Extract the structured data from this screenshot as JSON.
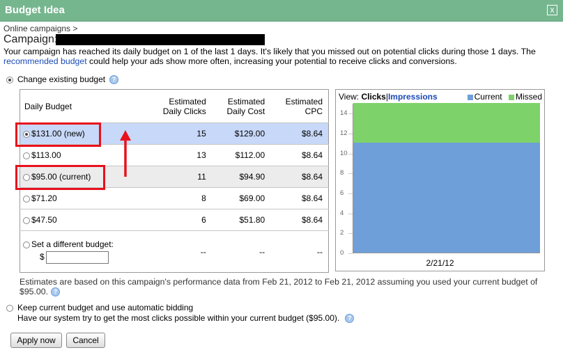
{
  "dialog": {
    "title": "Budget Idea",
    "close_label": "x",
    "breadcrumb": "Online campaigns >",
    "campaign_label": "Campaign:",
    "intro_text_before": "Your campaign has reached its daily budget on 1 of the last 1 days. It's likely that you missed out on potential clicks during those 1 days. The ",
    "intro_link": "recommended budget",
    "intro_text_after": " could help your ads show more often, increasing your potential to receive clicks and conversions."
  },
  "options": {
    "change_label": "Change existing budget",
    "keep_label": "Keep current budget and use automatic bidding",
    "keep_description": "Have our system try to get the most clicks possible within your current budget ($95.00)."
  },
  "table": {
    "headers": {
      "budget": "Daily Budget",
      "clicks_line1": "Estimated",
      "clicks_line2": "Daily Clicks",
      "cost_line1": "Estimated",
      "cost_line2": "Daily Cost",
      "cpc_line1": "Estimated",
      "cpc_line2": "CPC"
    },
    "rows": [
      {
        "budget": "$131.00",
        "tag": "(new)",
        "clicks": "15",
        "cost": "$129.00",
        "cpc": "$8.64"
      },
      {
        "budget": "$113.00",
        "tag": "",
        "clicks": "13",
        "cost": "$112.00",
        "cpc": "$8.64"
      },
      {
        "budget": "$95.00",
        "tag": "(current)",
        "clicks": "11",
        "cost": "$94.90",
        "cpc": "$8.64"
      },
      {
        "budget": "$71.20",
        "tag": "",
        "clicks": "8",
        "cost": "$69.00",
        "cpc": "$8.64"
      },
      {
        "budget": "$47.50",
        "tag": "",
        "clicks": "6",
        "cost": "$51.80",
        "cpc": "$8.64"
      }
    ],
    "different": {
      "label": "Set a different budget:",
      "currency": "$",
      "clicks": "--",
      "cost": "--",
      "cpc": "--"
    }
  },
  "chart_data": {
    "type": "bar",
    "view_label": "View:",
    "view_clicks": "Clicks",
    "view_separator": "|",
    "view_impressions": "Impressions",
    "categories": [
      "2/21/12"
    ],
    "series": [
      {
        "name": "Current",
        "values": [
          11
        ],
        "color": "#6f9fd8"
      },
      {
        "name": "Missed",
        "values": [
          4
        ],
        "color": "#7ed26a"
      }
    ],
    "stacked": true,
    "ylim": [
      0,
      15
    ],
    "yticks": [
      0,
      2,
      4,
      6,
      8,
      10,
      12,
      14
    ],
    "grid": false,
    "legend": "top-right"
  },
  "note": {
    "text": "Estimates are based on this campaign's performance data from Feb 21, 2012 to Feb 21, 2012 assuming you used your current budget of $95.00."
  },
  "buttons": {
    "apply": "Apply now",
    "cancel": "Cancel"
  },
  "colors": {
    "titlebar": "#76b68f",
    "selected_row": "#c8d8f8",
    "highlight": "#e8111d",
    "link": "#1a4ab8"
  }
}
